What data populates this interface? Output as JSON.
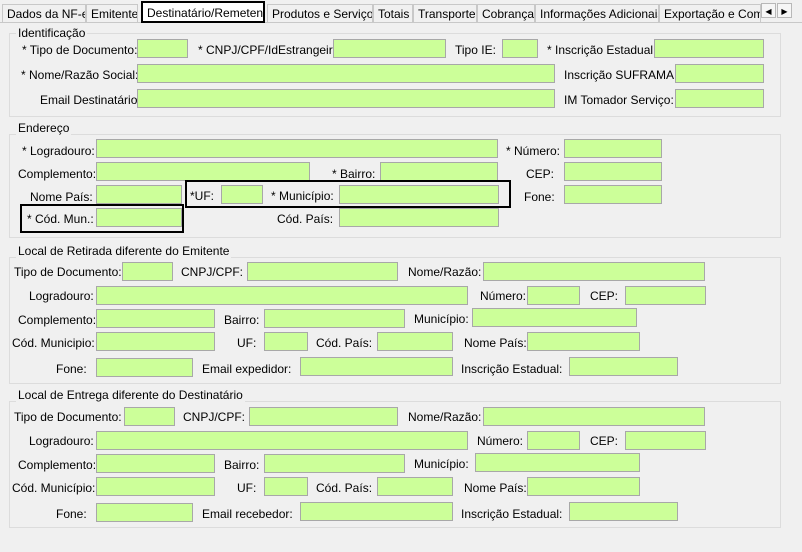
{
  "tabs": [
    "Dados da NF-e",
    "Emitente",
    "Destinatário/Remetente",
    "Produtos e Serviços",
    "Totais",
    "Transporte",
    "Cobrança",
    "Informações Adicionais",
    "Exportação e Compra"
  ],
  "nav": {
    "left": "◀",
    "right": "▶"
  },
  "identificacao": {
    "title": "Identificação",
    "tipo_documento": "* Tipo de Documento:",
    "cnpj_cpf_idestrangeiro": "* CNPJ/CPF/IdEstrangeiro:",
    "tipo_ie": "Tipo IE:",
    "inscricao_estadual": "* Inscrição Estadual:",
    "nome_razao_social": "* Nome/Razão Social:",
    "inscricao_suframa": "Inscrição SUFRAMA:",
    "email_destinatario": "Email Destinatário:",
    "im_tomador": "IM Tomador Serviço:"
  },
  "endereco": {
    "title": "Endereço",
    "logradouro": "* Logradouro:",
    "numero": "* Número:",
    "complemento": "Complemento:",
    "bairro": "* Bairro:",
    "cep": "CEP:",
    "nome_pais": "Nome País:",
    "uf": "*UF:",
    "municipio": "* Município:",
    "fone": "Fone:",
    "cod_mun": "* Cód. Mun.:",
    "cod_pais": "Cód. País:"
  },
  "retirada": {
    "title": "Local de Retirada diferente do Emitente",
    "tipo_documento": "Tipo de Documento:",
    "cnpj_cpf": "CNPJ/CPF:",
    "nome_razao": "Nome/Razão:",
    "logradouro": "Logradouro:",
    "numero": "Número:",
    "cep": "CEP:",
    "complemento": "Complemento:",
    "bairro": "Bairro:",
    "municipio": "Município:",
    "cod_municipio": "Cód. Municipio:",
    "uf": "UF:",
    "cod_pais": "Cód. País:",
    "nome_pais": "Nome País:",
    "fone": "Fone:",
    "email": "Email expedidor:",
    "inscricao_estadual": "Inscrição Estadual:"
  },
  "entrega": {
    "title": "Local de Entrega diferente do Destinatário",
    "tipo_documento": "Tipo de Documento:",
    "cnpj_cpf": "CNPJ/CPF:",
    "nome_razao": "Nome/Razão:",
    "logradouro": "Logradouro:",
    "numero": "Número:",
    "cep": "CEP:",
    "complemento": "Complemento:",
    "bairro": "Bairro:",
    "municipio": "Município:",
    "cod_municipio": "Cód. Município:",
    "uf": "UF:",
    "cod_pais": "Cód. País:",
    "nome_pais": "Nome País:",
    "fone": "Fone:",
    "email": "Email recebedor:",
    "inscricao_estadual": "Inscrição Estadual:"
  },
  "colors": {
    "input_bg": "#ccff99",
    "panel_bg": "#f0f0f0"
  }
}
